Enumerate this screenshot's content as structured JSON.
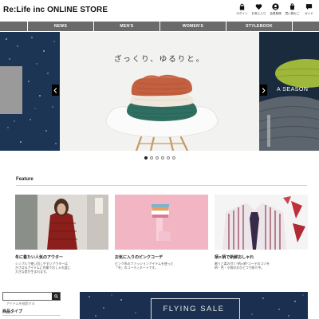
{
  "header": {
    "logo": "Re:Life inc ONLINE STORE",
    "icons": [
      {
        "icon": "lock-icon",
        "label": "ログイン"
      },
      {
        "icon": "heart-icon",
        "label": "お気に入り"
      },
      {
        "icon": "user-icon",
        "label": "会員登録"
      },
      {
        "icon": "cart-icon",
        "label": "買い物かご"
      },
      {
        "icon": "chat-icon",
        "label": "ガイド"
      }
    ]
  },
  "nav": {
    "items": [
      "NEWS",
      "MEN'S",
      "WOMEN'S",
      "STYLEBOOK"
    ]
  },
  "hero": {
    "main_copy": "ざっくり、ゆるりと。",
    "right_copy": "A SEASON",
    "dots_total": 6,
    "dots_active_index": 0
  },
  "feature": {
    "title": "Feature",
    "cards": [
      {
        "title": "冬に着たい人気のアウター",
        "desc": "シンプルで使い回しやすいアウターは\nかさばるアイテムに作業でおしゃれ度に\n大きな差が生まれます。"
      },
      {
        "title": "お気に入りのピンクコーデ",
        "desc": "ピンク系のファッションアイテムを使った\n「冬」のコーディネートです。"
      },
      {
        "title": "柄×柄で新鮮おしゃれ",
        "desc": "着りと柔の付く\"柄×柄\"コーデのコツを\n柄・色・小物のおひとつで紹介中。"
      }
    ]
  },
  "sidebar": {
    "search_placeholder": "アイテムを検索する",
    "category_label": "商品タイプ"
  },
  "sale_banner": {
    "text": "FLYING SALE"
  },
  "colors": {
    "nav_bg": "#6a6a6a",
    "navy": "#1b3050",
    "pink": "#f2b5c4"
  }
}
